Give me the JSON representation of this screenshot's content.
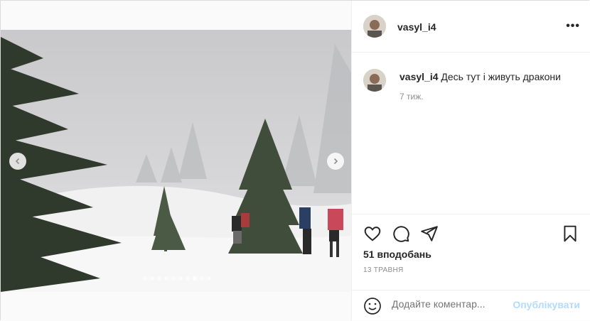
{
  "post": {
    "username": "vasyl_i4",
    "caption_text": "Десь тут і живуть дракони",
    "age": "7 тиж.",
    "likes": "51 вподобань",
    "date": "13 ТРАВНЯ"
  },
  "carousel": {
    "total": 10,
    "active_index": 7
  },
  "comment": {
    "placeholder": "Додайте коментар...",
    "publish_label": "Опублікувати"
  },
  "icons": {
    "more": "more-options-icon",
    "like": "heart-icon",
    "comment": "comment-icon",
    "share": "send-icon",
    "save": "bookmark-icon",
    "emoji": "emoji-icon",
    "prev": "chevron-left-icon",
    "next": "chevron-right-icon"
  },
  "colors": {
    "link_disabled": "#b3dbff",
    "muted": "#8e8e8e",
    "text": "#262626"
  }
}
